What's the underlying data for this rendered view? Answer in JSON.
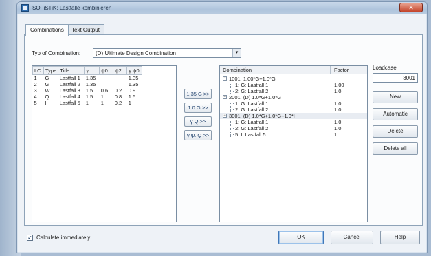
{
  "window": {
    "title": "SOFiSTiK: Lastfälle kombinieren",
    "close_glyph": "✕"
  },
  "tabs": [
    "Combinations",
    "Text Output"
  ],
  "combination_type": {
    "label": "Typ of Combination:",
    "value": "(D) Ultimate Design Combination",
    "arrow": "▾"
  },
  "lc_table": {
    "headers": [
      "LC",
      "Type",
      "Title",
      "γ",
      "ψ0",
      "ψ2",
      "γ ψ0"
    ],
    "rows": [
      [
        "1",
        "G",
        "Lastfall 1",
        "1.35",
        "",
        "",
        "1.35"
      ],
      [
        "2",
        "G",
        "Lastfall 2",
        "1.35",
        "",
        "",
        "1.35"
      ],
      [
        "3",
        "W",
        "Lastfall 3",
        "1.5",
        "0.6",
        "0.2",
        "0.9"
      ],
      [
        "4",
        "Q",
        "Lastfall 4",
        "1.5",
        "1",
        "0.8",
        "1.5"
      ],
      [
        "5",
        "I",
        "Lastfall 5",
        "1",
        "1",
        "0.2",
        "1"
      ]
    ]
  },
  "middle_buttons": [
    "1.35 G >>",
    "1.0 G >>",
    "γ Q >>",
    "γ ψ. Q >>"
  ],
  "tree": {
    "headers": {
      "combination": "Combination",
      "factor": "Factor"
    },
    "rows": [
      {
        "text": "1001: 1.00*G+1.0*G",
        "factor": "",
        "level": 0
      },
      {
        "text": "1: G: Lastfall 1",
        "factor": "1.00",
        "level": 1
      },
      {
        "text": "2: G: Lastfall 2",
        "factor": "1.0",
        "level": 1
      },
      {
        "text": "2001: (D) 1.0*G+1.0*G",
        "factor": "",
        "level": 0
      },
      {
        "text": "1: G: Lastfall 1",
        "factor": "1.0",
        "level": 1
      },
      {
        "text": "2: G: Lastfall 2",
        "factor": "1.0",
        "level": 1
      },
      {
        "text": "3001: (D) 1.0*G+1.0*G+1.0*I",
        "factor": "",
        "level": 0
      },
      {
        "text": "1: G: Lastfall 1",
        "factor": "1.0",
        "level": 1
      },
      {
        "text": "2: G: Lastfall 2",
        "factor": "1.0",
        "level": 1
      },
      {
        "text": "5: I: Lastfall 5",
        "factor": "1",
        "level": 1
      }
    ]
  },
  "loadcase": {
    "label": "Loadcase",
    "value": "3001"
  },
  "side_buttons": {
    "new": "New",
    "automatic": "Automatic",
    "delete": "Delete",
    "delete_all": "Delete all"
  },
  "footer": {
    "calculate_label": "Calculate immediately",
    "calculate_checked": true,
    "check_glyph": "✓",
    "ok": "OK",
    "cancel": "Cancel",
    "help": "Help"
  },
  "colors": {
    "desktop": "#a9bcd3",
    "dialog": "#eef2f7",
    "titlebar": "#aec4dc",
    "close": "#c3432a"
  }
}
